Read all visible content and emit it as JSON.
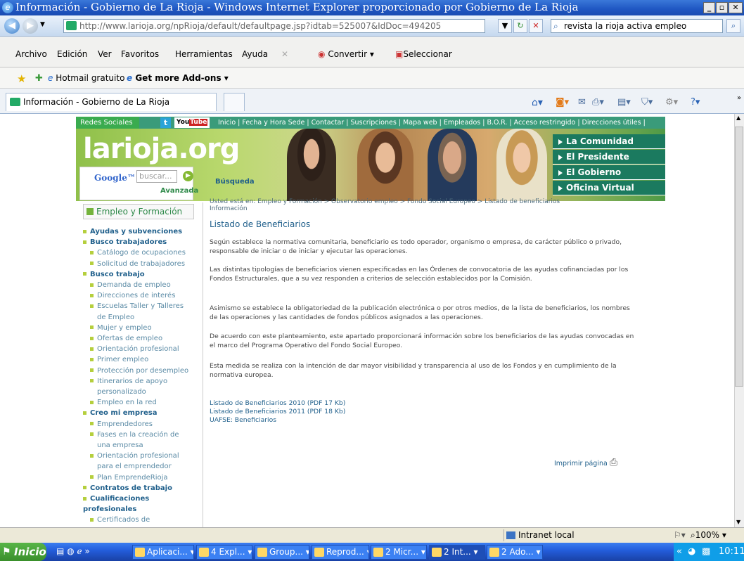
{
  "browser": {
    "title": "Información - Gobierno de La Rioja - Windows Internet Explorer proporcionado por Gobierno de La Rioja",
    "url": "http://www.larioja.org/npRioja/default/defaultpage.jsp?idtab=525007&IdDoc=494205",
    "search_text": "revista la rioja activa empleo",
    "menu": [
      "Archivo",
      "Edición",
      "Ver",
      "Favoritos",
      "Herramientas",
      "Ayuda"
    ],
    "toolbar": {
      "convertir": "Convertir",
      "seleccionar": "Seleccionar"
    },
    "favorites": {
      "hotmail": "Hotmail gratuito",
      "addons": "Get more Add-ons"
    },
    "tab_title": "Información - Gobierno de La Rioja",
    "status": {
      "zone": "Intranet local",
      "zoom": "100%"
    }
  },
  "site": {
    "topbar": {
      "redes": "Redes Sociales",
      "links": "Inicio | Fecha y Hora Sede | Contactar | Suscripciones | Mapa web | Empleados | B.O.R. | Acceso restringido | Direcciones útiles |"
    },
    "logo": "larioja.org",
    "google": {
      "placeholder": "buscar...",
      "button": "Búsqueda",
      "advanced": "Avanzada"
    },
    "right_menu": [
      "La Comunidad",
      "El Presidente",
      "El Gobierno",
      "Oficina Virtual"
    ],
    "sidebar": {
      "heading": "Empleo y Formación",
      "items": [
        {
          "t": "Ayudas y subvenciones",
          "lvl": 1
        },
        {
          "t": "Busco trabajadores",
          "lvl": 1
        },
        {
          "t": "Catálogo de ocupaciones",
          "lvl": 2
        },
        {
          "t": "Solicitud de trabajadores",
          "lvl": 2
        },
        {
          "t": "Busco trabajo",
          "lvl": 1
        },
        {
          "t": "Demanda de empleo",
          "lvl": 2
        },
        {
          "t": "Direcciones de interés",
          "lvl": 2
        },
        {
          "t": "Escuelas Taller y Talleres",
          "lvl": 2
        },
        {
          "t": "de Empleo",
          "lvl": 3
        },
        {
          "t": "Mujer y empleo",
          "lvl": 2
        },
        {
          "t": "Ofertas de empleo",
          "lvl": 2
        },
        {
          "t": "Orientación profesional",
          "lvl": 2
        },
        {
          "t": "Primer empleo",
          "lvl": 2
        },
        {
          "t": "Protección por desempleo",
          "lvl": 2
        },
        {
          "t": "Itinerarios de apoyo",
          "lvl": 2
        },
        {
          "t": "personalizado",
          "lvl": 3
        },
        {
          "t": "Empleo en la red",
          "lvl": 2
        },
        {
          "t": "Creo mi empresa",
          "lvl": 1
        },
        {
          "t": "Emprendedores",
          "lvl": 2
        },
        {
          "t": "Fases en la creación de",
          "lvl": 2
        },
        {
          "t": "una empresa",
          "lvl": 3
        },
        {
          "t": "Orientación profesional",
          "lvl": 2
        },
        {
          "t": "para el emprendedor",
          "lvl": 3
        },
        {
          "t": "Plan EmprendeRioja",
          "lvl": 2
        },
        {
          "t": "Contratos de trabajo",
          "lvl": 1
        },
        {
          "t": "Cualificaciones",
          "lvl": 1
        },
        {
          "t": "profesionales",
          "lvl": 4
        },
        {
          "t": "Certificados de",
          "lvl": 2
        }
      ]
    },
    "breadcrumb": "Usted está en: Empleo y Formación > Observatorio empleo > Fondo Social Europeo > Listado de beneficiarios  Información",
    "page_title": "Listado de Beneficiarios",
    "paragraphs": [
      "Según establece la normativa comunitaria, beneficiario es todo operador, organismo o empresa, de carácter público o privado, responsable de iniciar o de iniciar y ejecutar las operaciones.",
      "Las distintas tipologías de beneficiarios vienen especificadas en las Órdenes de convocatoria de las ayudas cofinanciadas por los Fondos Estructurales, que a su vez responden a criterios de selección establecidos por la Comisión.",
      "Asimismo se establece la obligatoriedad de la publicación electrónica o por otros medios, de la lista de beneficiarios, los nombres de las operaciones y las cantidades de fondos públicos asignados a las operaciones.",
      "De acuerdo con este planteamiento, este apartado proporcionará información sobre los beneficiarios de las ayudas convocadas en el marco del Programa Operativo del Fondo Social Europeo.",
      "Esta medida se realiza con la intención de dar mayor visibilidad y transparencia al uso de los Fondos y en cumplimiento de la normativa europea."
    ],
    "downloads": [
      "Listado de Beneficiarios 2010 (PDF 17 Kb)",
      "Listado de Beneficiarios 2011 (PDF 18 Kb)",
      "UAFSE: Beneficiarios"
    ],
    "print_label": "Imprimir página"
  },
  "taskbar": {
    "start": "Inicio",
    "tasks": [
      "Aplicaci...",
      "4 Expl...",
      "Group...",
      "Reprod...",
      "2 Micr...",
      "2 Int...",
      "2 Ado..."
    ],
    "clock": "10:11"
  }
}
